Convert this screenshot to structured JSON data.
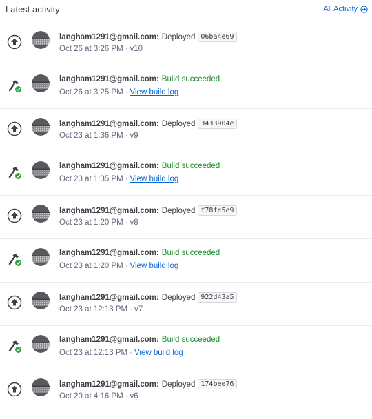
{
  "header": {
    "title": "Latest activity",
    "all_activity_label": "All Activity"
  },
  "colors": {
    "link": "#0a66d6",
    "success": "#1d8a2d",
    "badge_green": "#2fa343"
  },
  "items": [
    {
      "type": "deploy",
      "icon": "deploy-upload-icon",
      "user": "langham1291@gmail.com:",
      "action": "Deployed",
      "hash": "06ba4e69",
      "time": "Oct 26 at 3:26 PM",
      "version": "v10"
    },
    {
      "type": "build",
      "icon": "build-hammer-icon",
      "user": "langham1291@gmail.com:",
      "action": "Build succeeded",
      "time": "Oct 26 at 3:25 PM",
      "link": "View build log"
    },
    {
      "type": "deploy",
      "icon": "deploy-upload-icon",
      "user": "langham1291@gmail.com:",
      "action": "Deployed",
      "hash": "3433904e",
      "time": "Oct 23 at 1:36 PM",
      "version": "v9"
    },
    {
      "type": "build",
      "icon": "build-hammer-icon",
      "user": "langham1291@gmail.com:",
      "action": "Build succeeded",
      "time": "Oct 23 at 1:35 PM",
      "link": "View build log"
    },
    {
      "type": "deploy",
      "icon": "deploy-upload-icon",
      "user": "langham1291@gmail.com:",
      "action": "Deployed",
      "hash": "f78fe5e9",
      "time": "Oct 23 at 1:20 PM",
      "version": "v8"
    },
    {
      "type": "build",
      "icon": "build-hammer-icon",
      "user": "langham1291@gmail.com:",
      "action": "Build succeeded",
      "time": "Oct 23 at 1:20 PM",
      "link": "View build log"
    },
    {
      "type": "deploy",
      "icon": "deploy-upload-icon",
      "user": "langham1291@gmail.com:",
      "action": "Deployed",
      "hash": "922d43a5",
      "time": "Oct 23 at 12:13 PM",
      "version": "v7"
    },
    {
      "type": "build",
      "icon": "build-hammer-icon",
      "user": "langham1291@gmail.com:",
      "action": "Build succeeded",
      "time": "Oct 23 at 12:13 PM",
      "link": "View build log"
    },
    {
      "type": "deploy",
      "icon": "deploy-upload-icon",
      "user": "langham1291@gmail.com:",
      "action": "Deployed",
      "hash": "174bee76",
      "time": "Oct 20 at 4:16 PM",
      "version": "v6"
    }
  ]
}
